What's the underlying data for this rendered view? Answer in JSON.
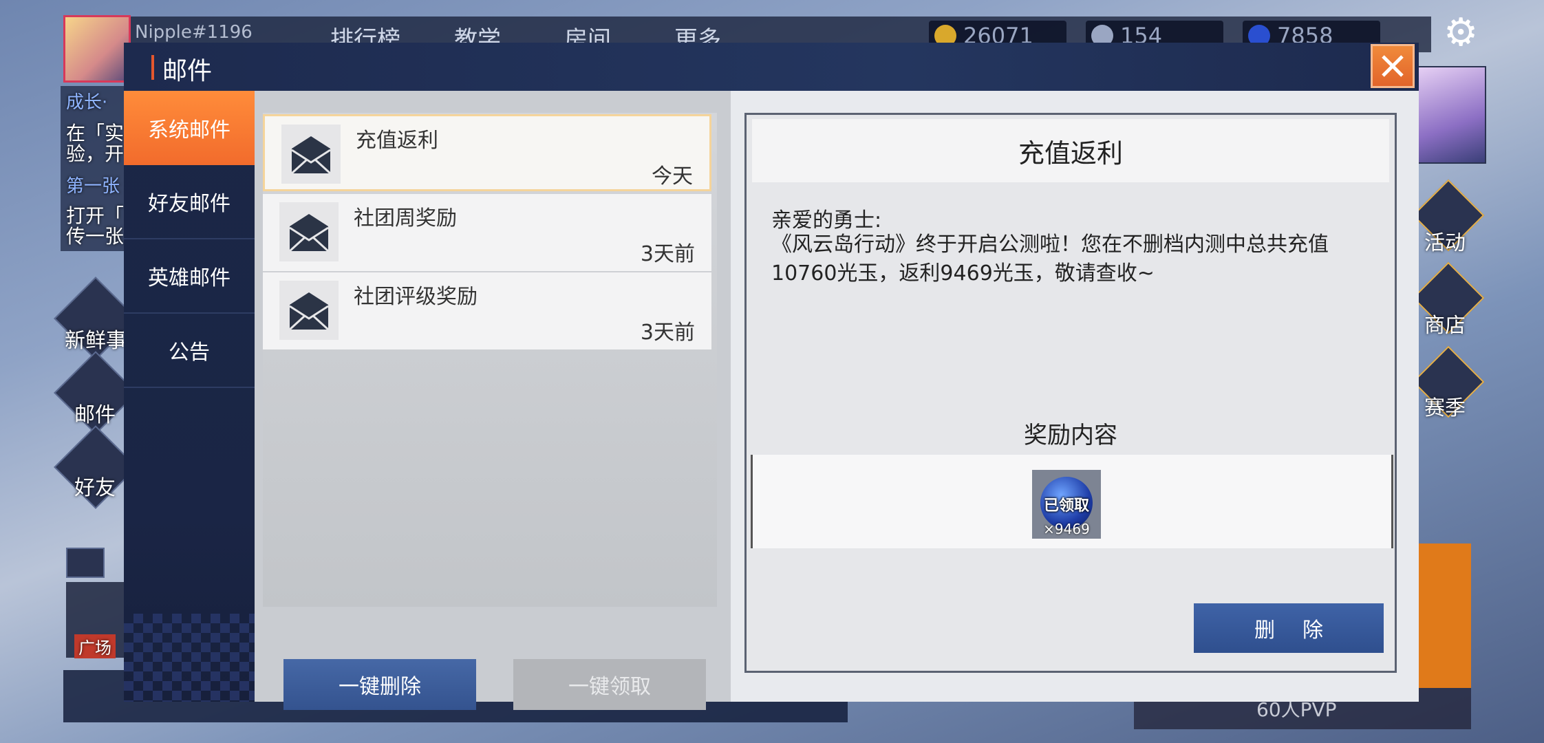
{
  "background_hud": {
    "player_name": "Nipple#1196",
    "nav": [
      "排行榜",
      "教学",
      "房间",
      "更多"
    ],
    "resources": [
      {
        "icon": "gold-coin-icon",
        "value": "26071",
        "color": "#d9a82c"
      },
      {
        "icon": "feather-icon",
        "value": "154",
        "color": "#9aa6c2"
      },
      {
        "icon": "blue-gem-icon",
        "value": "7858",
        "color": "#2a4fd0"
      }
    ],
    "left_menu": [
      "新鲜事",
      "邮件",
      "好友"
    ],
    "right_menu": [
      "活动",
      "商店",
      "赛季"
    ],
    "left_notes": [
      "成长·",
      "在「实",
      "验，开",
      "第一张",
      "打开「",
      "传一张"
    ],
    "chat_label": "广场",
    "pvp_label": "60人PVP"
  },
  "dialog": {
    "title": "邮件",
    "close_icon": "close-icon",
    "tabs": [
      {
        "label": "系统邮件",
        "active": true
      },
      {
        "label": "好友邮件",
        "active": false
      },
      {
        "label": "英雄邮件",
        "active": false
      },
      {
        "label": "公告",
        "active": false
      }
    ],
    "mails": [
      {
        "title": "充值返利",
        "time": "今天",
        "selected": true
      },
      {
        "title": "社团周奖励",
        "time": "3天前",
        "selected": false
      },
      {
        "title": "社团评级奖励",
        "time": "3天前",
        "selected": false
      }
    ],
    "buttons": {
      "delete_all": "一键删除",
      "claim_all": "一键领取"
    },
    "detail": {
      "title": "充值返利",
      "greeting": "亲爱的勇士:",
      "body": "《风云岛行动》终于开启公测啦！您在不删档内测中总共充值10760光玉，返利9469光玉，敬请查收~",
      "reward_heading": "奖励内容",
      "reward": {
        "status": "已领取",
        "count": "×9469",
        "icon": "light-jade-icon"
      },
      "delete_label": "删除"
    }
  }
}
